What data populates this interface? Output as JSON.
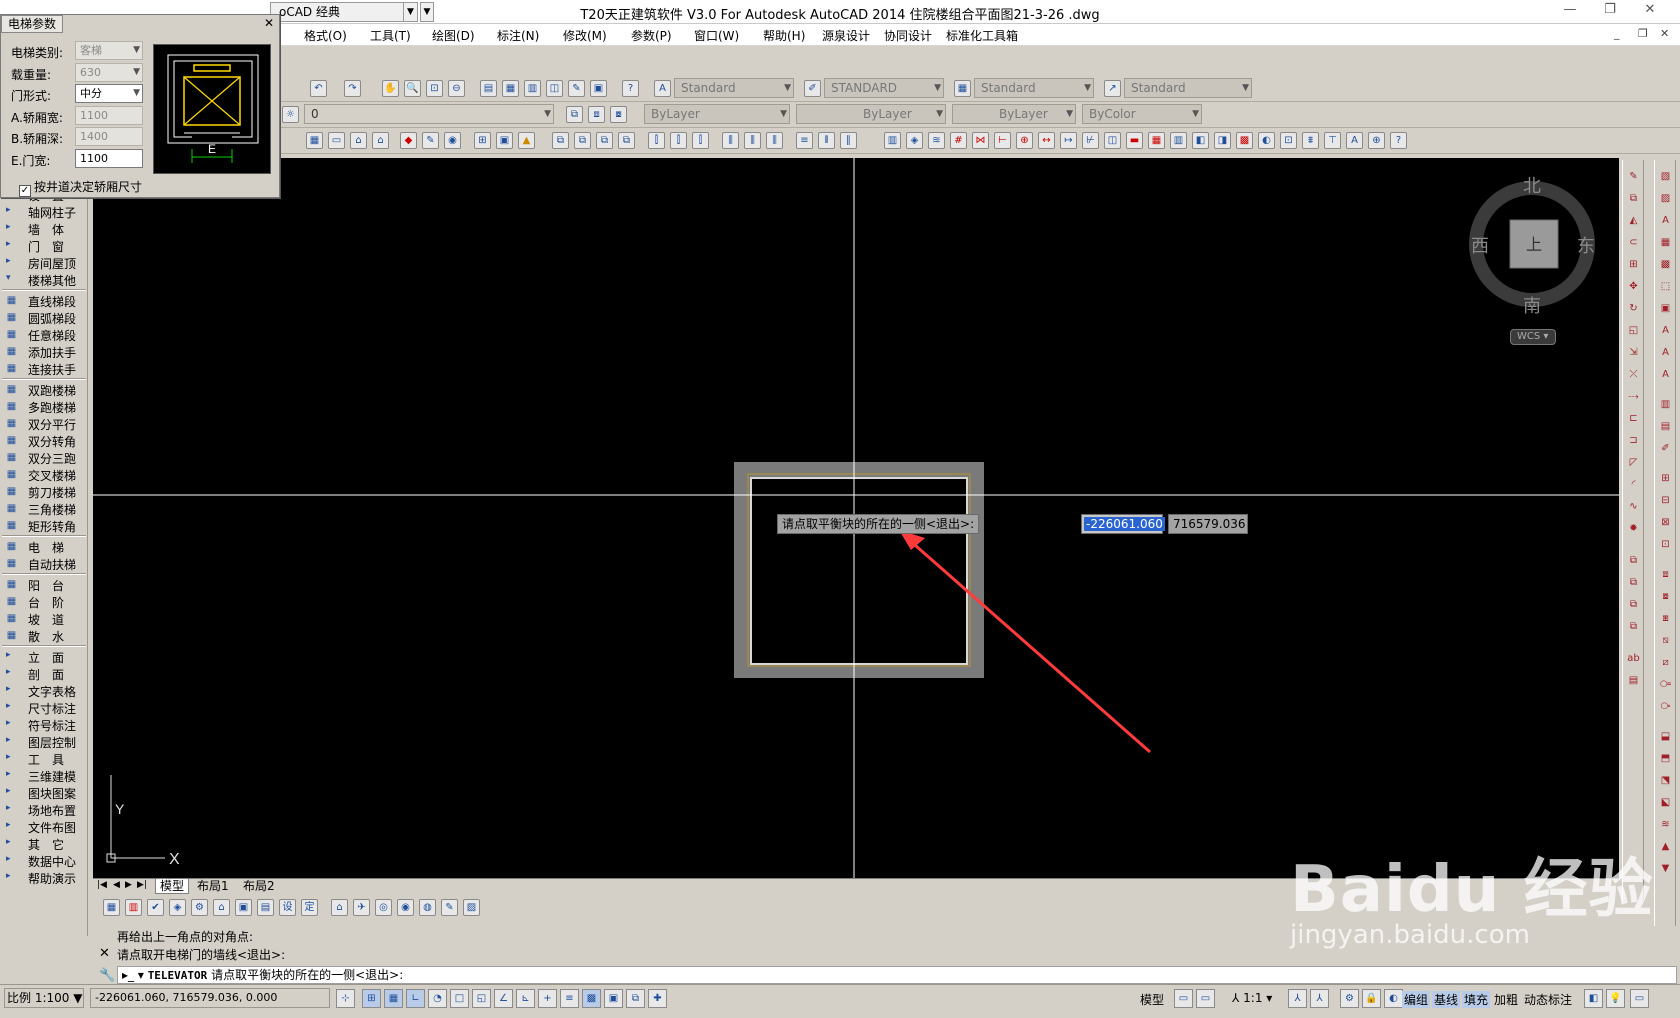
{
  "window": {
    "title": "T20天正建筑软件 V3.0 For Autodesk AutoCAD 2014    住院楼组合平面图21-3-26 .dwg",
    "workspace": "oCAD 经典"
  },
  "menu": {
    "items": [
      "格式(O)",
      "工具(T)",
      "绘图(D)",
      "标注(N)",
      "修改(M)",
      "参数(P)",
      "窗口(W)",
      "帮助(H)",
      "源泉设计",
      "协同设计",
      "标准化工具箱"
    ]
  },
  "toolbar": {
    "text_style": "Standard",
    "dim_style": "STANDARD",
    "table_style": "Standard",
    "multileader_style": "Standard",
    "layer": "0",
    "color": "ByLayer",
    "linetype": "ByLayer",
    "lineweight": "ByLayer",
    "plotstyle": "ByColor"
  },
  "dialog": {
    "title": "电梯参数",
    "fields": [
      {
        "label": "电梯类别:",
        "value": "客梯",
        "active": false,
        "dropdown": true
      },
      {
        "label": "载重量:",
        "value": "630",
        "active": false,
        "dropdown": true
      },
      {
        "label": "门形式:",
        "value": "中分",
        "active": true,
        "dropdown": true
      },
      {
        "label": "A.轿厢宽:",
        "value": "1100",
        "active": false,
        "dropdown": false
      },
      {
        "label": "B.轿厢深:",
        "value": "1400",
        "active": false,
        "dropdown": false
      },
      {
        "label": "E.门宽:",
        "value": "1100",
        "active": true,
        "dropdown": false
      }
    ],
    "checkbox_label": "按井道决定轿厢尺寸",
    "preview_label": "E"
  },
  "palette": {
    "items": [
      {
        "label": "设　置",
        "type": "group"
      },
      {
        "label": "轴网柱子",
        "type": "group"
      },
      {
        "label": "墙　体",
        "type": "group"
      },
      {
        "label": "门　窗",
        "type": "group"
      },
      {
        "label": "房间屋顶",
        "type": "group"
      },
      {
        "label": "楼梯其他",
        "type": "open"
      },
      {
        "label": "直线梯段",
        "type": "tool"
      },
      {
        "label": "圆弧梯段",
        "type": "tool"
      },
      {
        "label": "任意梯段",
        "type": "tool"
      },
      {
        "label": "添加扶手",
        "type": "tool"
      },
      {
        "label": "连接扶手",
        "type": "tool"
      },
      {
        "label": "双跑楼梯",
        "type": "tool"
      },
      {
        "label": "多跑楼梯",
        "type": "tool"
      },
      {
        "label": "双分平行",
        "type": "tool"
      },
      {
        "label": "双分转角",
        "type": "tool"
      },
      {
        "label": "双分三跑",
        "type": "tool"
      },
      {
        "label": "交叉楼梯",
        "type": "tool"
      },
      {
        "label": "剪刀楼梯",
        "type": "tool"
      },
      {
        "label": "三角楼梯",
        "type": "tool"
      },
      {
        "label": "矩形转角",
        "type": "tool"
      },
      {
        "label": "电　梯",
        "type": "tool"
      },
      {
        "label": "自动扶梯",
        "type": "tool"
      },
      {
        "label": "阳　台",
        "type": "tool"
      },
      {
        "label": "台　阶",
        "type": "tool"
      },
      {
        "label": "坡　道",
        "type": "tool"
      },
      {
        "label": "散　水",
        "type": "tool"
      },
      {
        "label": "立　面",
        "type": "group"
      },
      {
        "label": "剖　面",
        "type": "group"
      },
      {
        "label": "文字表格",
        "type": "group"
      },
      {
        "label": "尺寸标注",
        "type": "group"
      },
      {
        "label": "符号标注",
        "type": "group"
      },
      {
        "label": "图层控制",
        "type": "group"
      },
      {
        "label": "工　具",
        "type": "group"
      },
      {
        "label": "三维建模",
        "type": "group"
      },
      {
        "label": "图块图案",
        "type": "group"
      },
      {
        "label": "场地布置",
        "type": "group"
      },
      {
        "label": "文件布图",
        "type": "group"
      },
      {
        "label": "其　它",
        "type": "group"
      },
      {
        "label": "数据中心",
        "type": "group"
      },
      {
        "label": "帮助演示",
        "type": "group"
      }
    ]
  },
  "canvas": {
    "prompt": "请点取平衡块的所在的一侧<退出>:",
    "coord_x": "-226061.060",
    "coord_y": "716579.036",
    "compass": {
      "n": "北",
      "s": "南",
      "w": "西",
      "e": "东",
      "top": "上",
      "wcs": "WCS"
    },
    "ucs_x": "X",
    "ucs_y": "Y",
    "accent": "#ff3b3b"
  },
  "layout_tabs": [
    "模型",
    "布局1",
    "布局2"
  ],
  "bottom_toolbar": {
    "b1": "设",
    "b2": "定"
  },
  "command": {
    "history": [
      "再给出上一角点的对角点:",
      "请点取开电梯门的墙线<退出>:"
    ],
    "current_cmd": "TELEVATOR",
    "current_prompt": "请点取平衡块的所在的一侧<退出>:"
  },
  "status": {
    "scale": "比例 1:100",
    "coords": "-226061.060, 716579.036, 0.000",
    "model": "模型",
    "anno_scale": "1:1",
    "group": "编组",
    "baseline": "基线",
    "fill": "填充",
    "bold": "加粗",
    "dynamic": "动态标注"
  },
  "watermark": {
    "brand": "Baidu 经验",
    "url": "jingyan.baidu.com"
  }
}
